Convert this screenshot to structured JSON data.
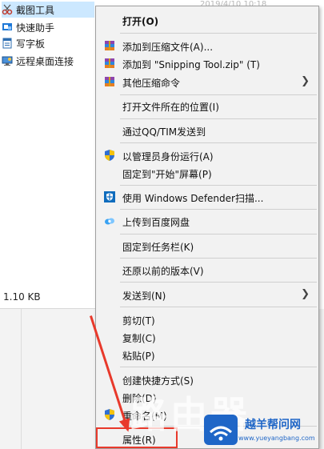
{
  "explorer": {
    "items": [
      {
        "name": "截图工具",
        "icon": "scissors-icon"
      },
      {
        "name": "快速助手",
        "icon": "quick-assist-icon"
      },
      {
        "name": "写字板",
        "icon": "wordpad-icon"
      },
      {
        "name": "远程桌面连接",
        "icon": "remote-desktop-icon"
      }
    ],
    "faded_date": "2019/4/10 10:18",
    "size": "1.10 KB"
  },
  "menu": {
    "open": "打开(O)",
    "add_archive": "添加到压缩文件(A)...",
    "add_zip": "添加到 \"Snipping Tool.zip\" (T)",
    "other_compress": "其他压缩命令",
    "open_location": "打开文件所在的位置(I)",
    "send_qq": "通过QQ/TIM发送到",
    "run_admin": "以管理员身份运行(A)",
    "pin_start": "固定到\"开始\"屏幕(P)",
    "defender": "使用 Windows Defender扫描...",
    "baidu": "上传到百度网盘",
    "pin_taskbar": "固定到任务栏(K)",
    "restore": "还原以前的版本(V)",
    "send_to": "发送到(N)",
    "cut": "剪切(T)",
    "copy": "复制(C)",
    "paste": "粘贴(P)",
    "shortcut": "创建快捷方式(S)",
    "delete": "删除(D)",
    "rename": "重命名(M)",
    "properties": "属性(R)"
  },
  "watermark": {
    "title": "路由器",
    "logo": "路由器之家",
    "site_title": "越羊帮问网",
    "site_url": "www.yueyangbang.com"
  },
  "colors": {
    "highlight": "#e8392b",
    "selection": "#cce8ff",
    "menu_bg": "#f2f2f2",
    "brand_blue": "#1f66c7"
  }
}
